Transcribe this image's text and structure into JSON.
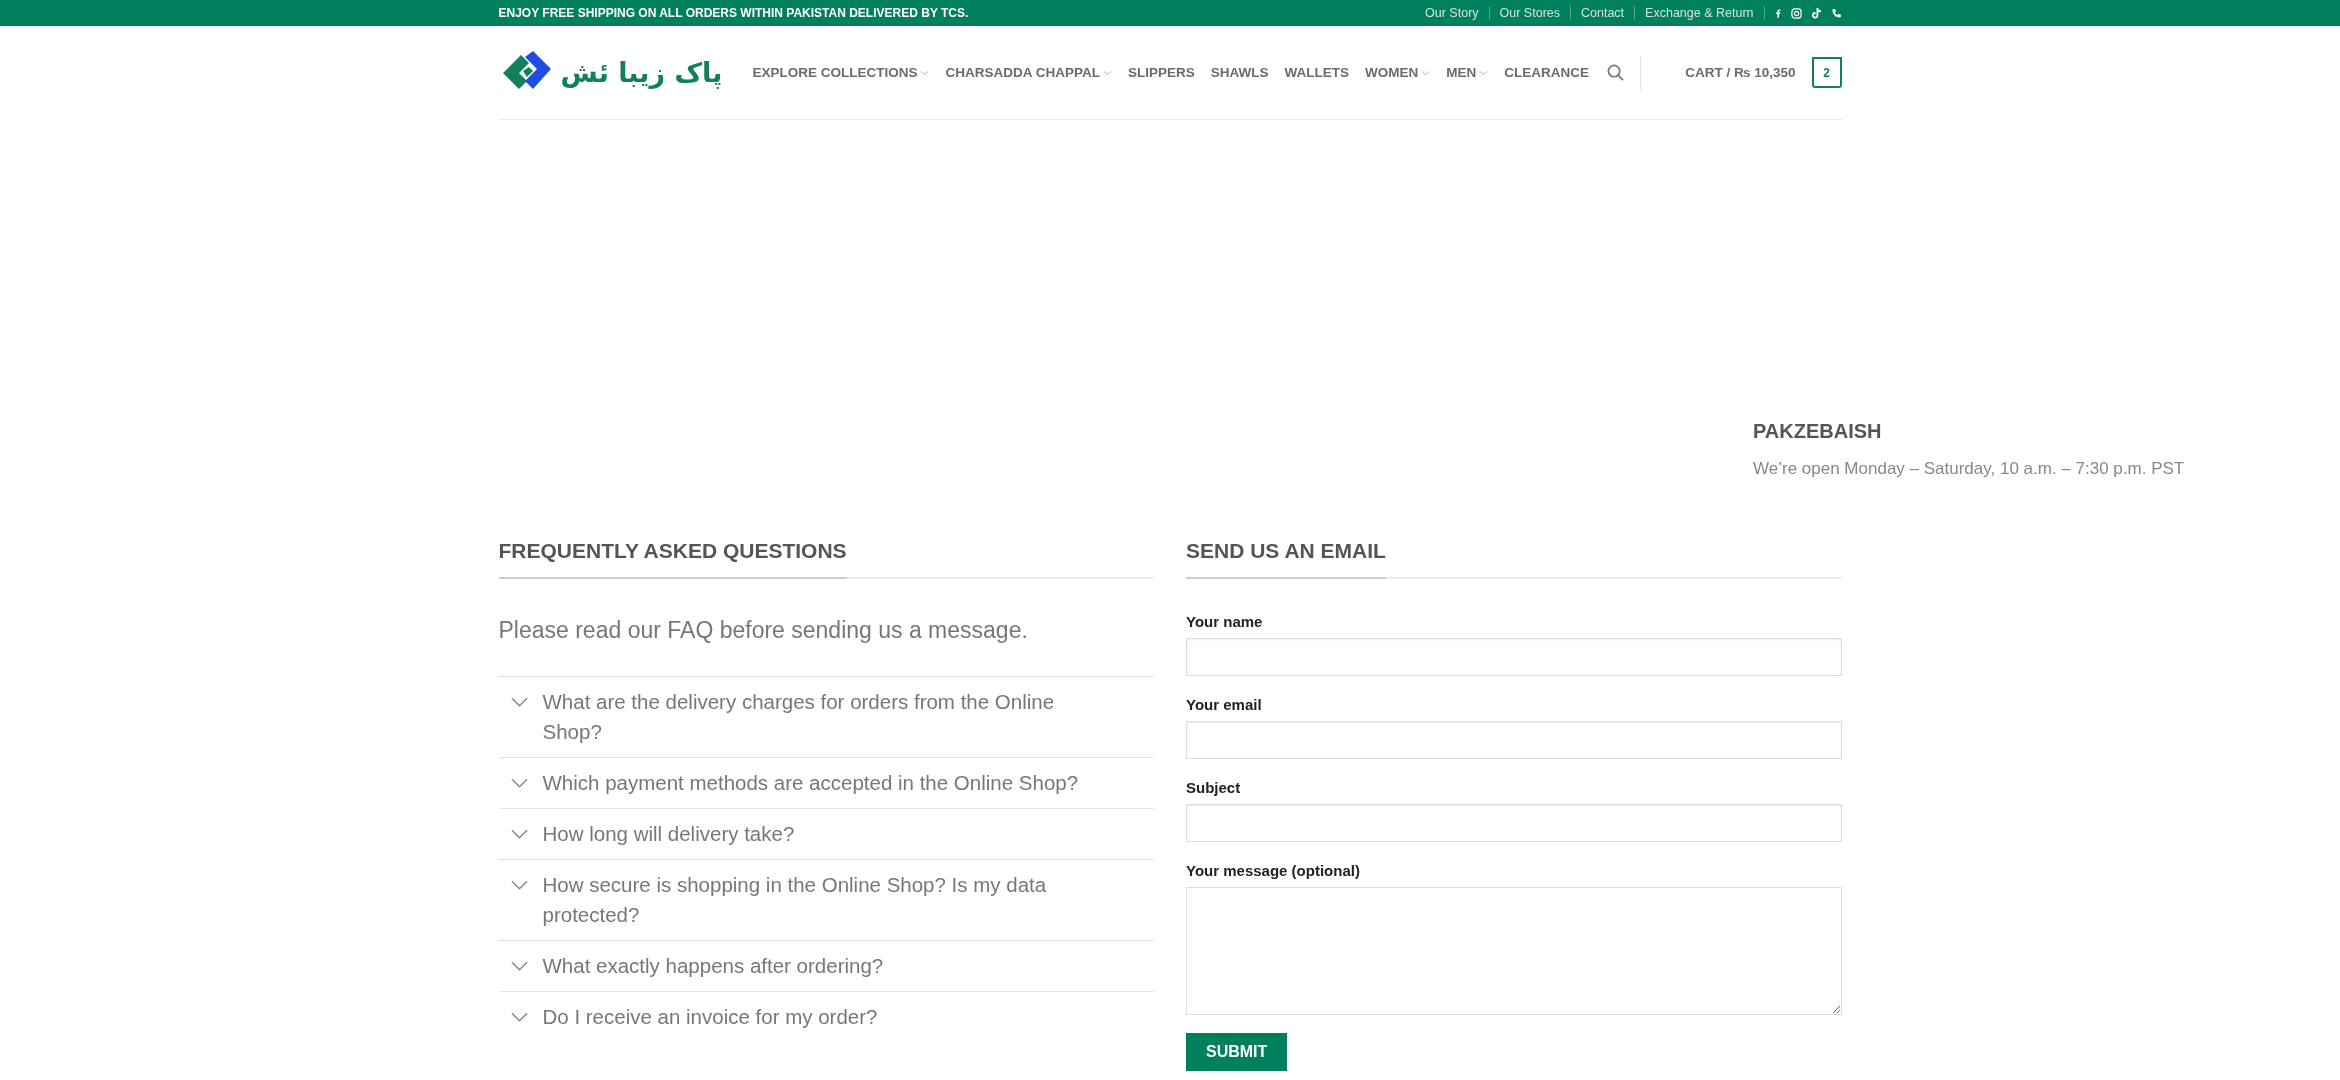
{
  "top_bar": {
    "announcement": "ENJOY FREE SHIPPING ON ALL ORDERS WITHIN PAKISTAN DELIVERED BY TCS.",
    "links": [
      "Our Story",
      "Our Stores",
      "Contact",
      "Exchange & Return"
    ]
  },
  "header": {
    "logo_text": "پاک زیبا ئش",
    "nav": [
      {
        "label": "EXPLORE COLLECTIONS",
        "dropdown": true
      },
      {
        "label": "CHARSADDA CHAPPAL",
        "dropdown": true
      },
      {
        "label": "SLIPPERS",
        "dropdown": false
      },
      {
        "label": "SHAWLS",
        "dropdown": false
      },
      {
        "label": "WALLETS",
        "dropdown": false
      },
      {
        "label": "WOMEN",
        "dropdown": true
      },
      {
        "label": "MEN",
        "dropdown": true
      },
      {
        "label": "CLEARANCE",
        "dropdown": false
      }
    ],
    "cart": {
      "label": "CART / ₨ 10,350",
      "count": "2"
    }
  },
  "store_info": {
    "title": "PAKZEBAISH",
    "hours": "We’re open Monday – Saturday, 10 a.m. – 7:30 p.m. PST"
  },
  "faq": {
    "title": "FREQUENTLY ASKED QUESTIONS",
    "intro": "Please read our FAQ before sending us a message.",
    "items": [
      {
        "question": "What are the delivery charges for orders from the Online Shop?",
        "expanded": false
      },
      {
        "question": "Which payment methods are accepted in the Online Shop?",
        "expanded": false
      },
      {
        "question": "How long will delivery take?",
        "expanded": false
      },
      {
        "question": "How secure is shopping in the Online Shop? Is my data protected?",
        "expanded": false
      },
      {
        "question": "What exactly happens after ordering?",
        "expanded": false
      },
      {
        "question": "Do I receive an invoice for my order?",
        "expanded": false
      }
    ]
  },
  "contact_form": {
    "title": "SEND US AN EMAIL",
    "fields": [
      {
        "label": "Your name",
        "kind": "text"
      },
      {
        "label": "Your email",
        "kind": "text"
      },
      {
        "label": "Subject",
        "kind": "text"
      },
      {
        "label": "Your message (optional)",
        "kind": "textarea"
      }
    ],
    "submit": "SUBMIT"
  }
}
